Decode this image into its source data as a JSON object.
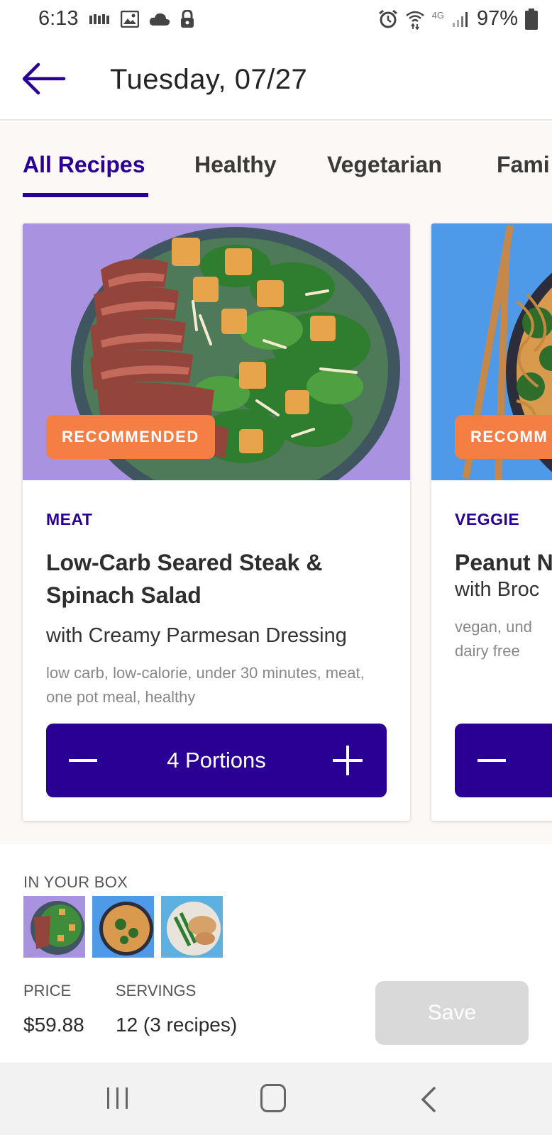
{
  "status_bar": {
    "time": "6:13",
    "battery": "97%",
    "network": "4G"
  },
  "header": {
    "date": "Tuesday, 07/27"
  },
  "tabs": [
    {
      "label": "All Recipes",
      "active": true
    },
    {
      "label": "Healthy",
      "active": false
    },
    {
      "label": "Vegetarian",
      "active": false
    },
    {
      "label": "Fami",
      "active": false
    }
  ],
  "cards": [
    {
      "badge": "RECOMMENDED",
      "category": "MEAT",
      "title": "Low-Carb Seared Steak & Spinach Salad",
      "subtitle": "with Creamy Parmesan Dressing",
      "tags": "low carb, low-calorie, under 30 minutes, meat, one pot meal, healthy",
      "portions": "4 Portions"
    },
    {
      "badge": "RECOMM",
      "category": "VEGGIE",
      "title": "Peanut N",
      "subtitle": "with Broc",
      "tags": "vegan, und dairy free"
    }
  ],
  "summary": {
    "box_label": "IN YOUR BOX",
    "price_label": "PRICE",
    "price_value": "$59.88",
    "servings_label": "SERVINGS",
    "servings_value": "12 (3 recipes)",
    "save_label": "Save"
  },
  "colors": {
    "brand": "#2a0094",
    "badge": "#f57e45",
    "save_disabled": "#d9d9d9"
  }
}
